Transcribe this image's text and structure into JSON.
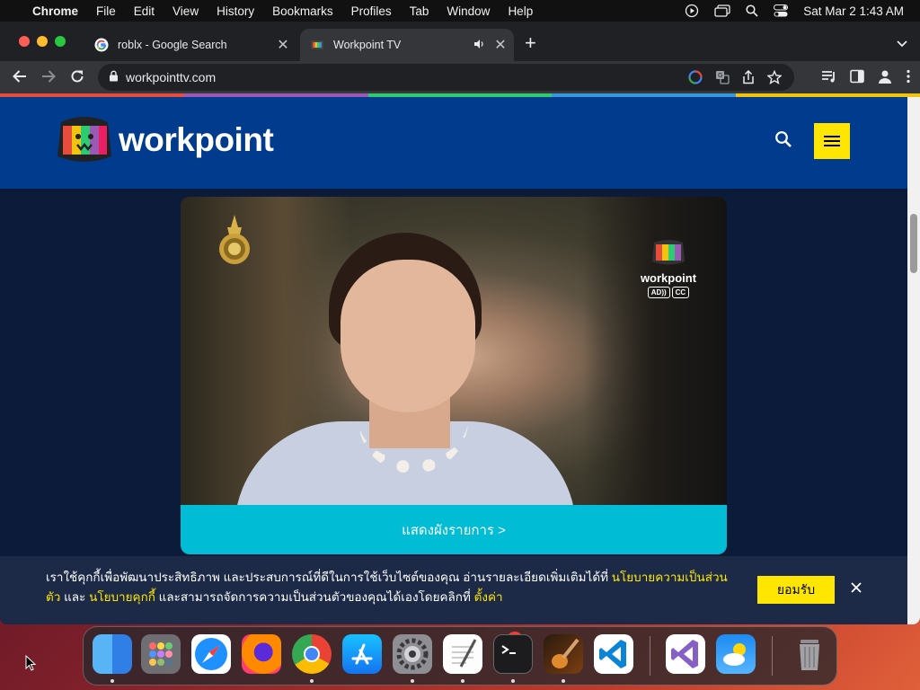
{
  "menubar": {
    "app_name": "Chrome",
    "items": [
      "File",
      "Edit",
      "View",
      "History",
      "Bookmarks",
      "Profiles",
      "Tab",
      "Window",
      "Help"
    ],
    "datetime": "Sat Mar 2  1:43 AM"
  },
  "browser": {
    "tabs": [
      {
        "title": "roblx - Google Search",
        "favicon": "google-icon",
        "active": false
      },
      {
        "title": "Workpoint TV",
        "favicon": "workpoint-icon",
        "active": true,
        "audio": true
      }
    ],
    "url": "workpointtv.com"
  },
  "site": {
    "logo_text": "workpoint",
    "video_overlay": {
      "logo_text": "workpoint",
      "badges": [
        "AD))",
        "CC"
      ]
    },
    "schedule_label": "แสดงผังรายการ >",
    "cookie": {
      "text_1": "เราใช้คุกกี้เพื่อพัฒนาประสิทธิภาพ และประสบการณ์ที่ดีในการใช้เว็บไซต์ของคุณ อ่านรายละเอียดเพิ่มเติมได้ที่ ",
      "link_1": "นโยบายความเป็นส่วนตัว",
      "text_2": " และ ",
      "link_2": "นโยบายคุกกี้",
      "text_3": " และสามารถจัดการความเป็นส่วนตัวของคุณได้เองโดยคลิกที่ ",
      "link_3": "ตั้งค่า",
      "accept_label": "ยอมรับ"
    }
  },
  "dock": {
    "apps": [
      "finder",
      "launchpad",
      "safari",
      "firefox",
      "chrome",
      "app-store",
      "system-preferences",
      "textedit",
      "terminal",
      "garageband",
      "vscode",
      "visual-studio",
      "weather",
      "trash"
    ],
    "notification_badge": "1"
  },
  "colors": {
    "site_header": "#003b8e",
    "accent_yellow": "#ffe600",
    "schedule_cyan": "#00bcd4"
  }
}
